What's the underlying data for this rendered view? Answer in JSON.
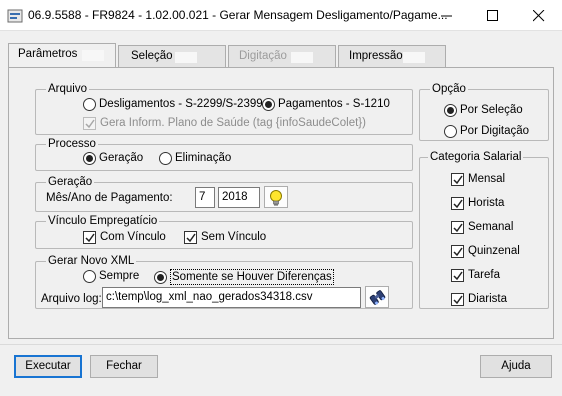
{
  "window": {
    "title": "06.9.5588 - FR9824 - 1.02.00.021 - Gerar Mensagem Desligamento/Pagame...",
    "icon": "app-icon"
  },
  "tabs": [
    {
      "label": "Parâmetros",
      "active": true
    },
    {
      "label": "Seleção",
      "active": false
    },
    {
      "label": "Digitação",
      "active": false,
      "disabled": true
    },
    {
      "label": "Impressão",
      "active": false
    }
  ],
  "arquivo": {
    "title": "Arquivo",
    "opt_desligamentos": "Desligamentos - S-2299/S-2399",
    "opt_pagamentos": "Pagamentos - S-1210",
    "selected": "pagamentos",
    "gera_plano": "Gera Inform. Plano de Saúde (tag {infoSaudeColet})"
  },
  "opcao": {
    "title": "Opção",
    "por_selecao": "Por Seleção",
    "por_digitacao": "Por Digitação",
    "selected": "por_selecao"
  },
  "processo": {
    "title": "Processo",
    "geracao": "Geração",
    "eliminacao": "Eliminação",
    "selected": "geracao"
  },
  "geracao": {
    "title": "Geração",
    "mes_ano_label": "Mês/Ano de Pagamento:",
    "mes": "7",
    "ano": "2018",
    "hint_icon": "lightbulb-icon"
  },
  "vinculo": {
    "title": "Vínculo Empregatício",
    "com_vinculo": "Com Vínculo",
    "sem_vinculo": "Sem Vínculo",
    "com_checked": true,
    "sem_checked": true
  },
  "xml": {
    "title": "Gerar Novo XML",
    "sempre": "Sempre",
    "somente": "Somente se Houver Diferenças",
    "selected": "somente",
    "arquivo_log_label": "Arquivo log:",
    "arquivo_log_value": "c:\\temp\\log_xml_nao_gerados34318.csv",
    "browse_icon": "binoculars-icon"
  },
  "categoria": {
    "title": "Categoria Salarial",
    "items": [
      {
        "label": "Mensal",
        "checked": true
      },
      {
        "label": "Horista",
        "checked": true
      },
      {
        "label": "Semanal",
        "checked": true
      },
      {
        "label": "Quinzenal",
        "checked": true
      },
      {
        "label": "Tarefa",
        "checked": true
      },
      {
        "label": "Diarista",
        "checked": true
      }
    ]
  },
  "buttons": {
    "executar": "Executar",
    "fechar": "Fechar",
    "ajuda": "Ajuda"
  }
}
